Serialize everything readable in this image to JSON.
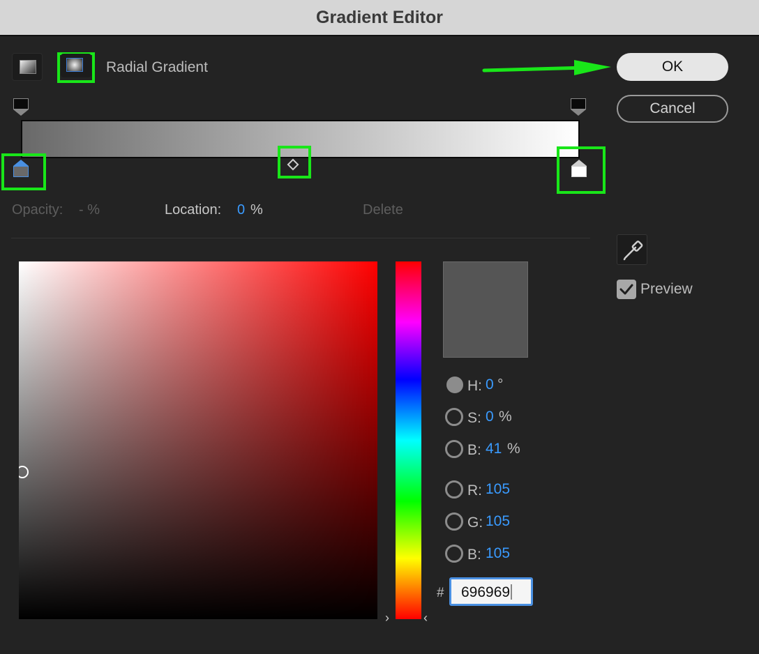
{
  "window": {
    "title": "Gradient Editor"
  },
  "gradient_type": {
    "label": "Radial Gradient",
    "selected": "radial"
  },
  "buttons": {
    "ok": "OK",
    "cancel": "Cancel"
  },
  "stop_controls": {
    "opacity_label": "Opacity:",
    "opacity_value": "- %",
    "location_label": "Location:",
    "location_value": "0",
    "location_unit": "%",
    "delete_label": "Delete"
  },
  "gradient": {
    "start_color": "#696969",
    "end_color": "#ffffff",
    "midpoint": 0.5
  },
  "color_modes": [
    {
      "key": "H",
      "label": "H:",
      "value": "0",
      "unit": "°",
      "selected": true
    },
    {
      "key": "S",
      "label": "S:",
      "value": "0",
      "unit": "%",
      "selected": false
    },
    {
      "key": "Bri",
      "label": "B:",
      "value": "41",
      "unit": "%",
      "selected": false
    },
    {
      "key": "R",
      "label": "R:",
      "value": "105",
      "unit": "",
      "selected": false
    },
    {
      "key": "G",
      "label": "G:",
      "value": "105",
      "unit": "",
      "selected": false
    },
    {
      "key": "Blue",
      "label": "B:",
      "value": "105",
      "unit": "",
      "selected": false
    }
  ],
  "hex": {
    "prefix": "#",
    "value": "696969"
  },
  "preview": {
    "label": "Preview",
    "checked": true
  },
  "colors": {
    "highlight": "#19e619",
    "accent": "#3a9bff",
    "swatch": "#555555"
  },
  "icons": [
    "linear-gradient-icon",
    "radial-gradient-icon",
    "eyedropper-icon",
    "checkmark-icon",
    "arrow-annotation"
  ]
}
